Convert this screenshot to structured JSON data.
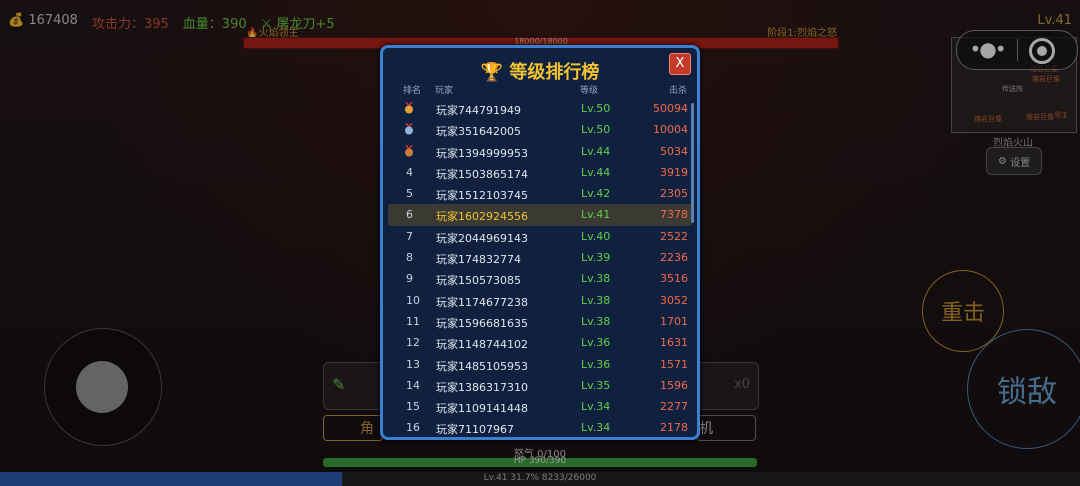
{
  "hud": {
    "gold": "167408",
    "attack": "攻击力：395",
    "health": "血量：390",
    "weapon": "屠龙刀+5",
    "level": "Lv.41"
  },
  "boss": {
    "name": "火焰领主",
    "stage": "阶段1:烈焰之怒",
    "hp_text": "18000/18000",
    "hp_fraction": 1.0
  },
  "minimap": {
    "name": "烈焰火山",
    "labels": [
      "熔岩巨像",
      "传送阵",
      "熔岩巨像",
      "熔岩巨像",
      "熔岩巨像",
      "领主"
    ]
  },
  "settings_label": "设置",
  "controls": {
    "heavy_attack": "重击",
    "lock_target": "锁敌"
  },
  "bottom": {
    "pen_count": "x0",
    "left_button": "角",
    "right_button": "机",
    "rage": "怒气 0/100",
    "hp": "HP 390/390",
    "hp_fraction": 1.0,
    "exp": "Lv.41  31.7%  8233/26000",
    "exp_fraction": 0.317
  },
  "leaderboard": {
    "title": "等级排行榜",
    "close": "X",
    "headers": {
      "rank": "排名",
      "player": "玩家",
      "level": "等级",
      "kills": "击杀"
    },
    "rows": [
      {
        "rank": "1",
        "name": "玩家744791949",
        "level": "Lv.50",
        "kills": "50094",
        "medal": "gold"
      },
      {
        "rank": "2",
        "name": "玩家351642005",
        "level": "Lv.50",
        "kills": "10004",
        "medal": "silver"
      },
      {
        "rank": "3",
        "name": "玩家1394999953",
        "level": "Lv.44",
        "kills": "5034",
        "medal": "bronze"
      },
      {
        "rank": "4",
        "name": "玩家1503865174",
        "level": "Lv.44",
        "kills": "3919"
      },
      {
        "rank": "5",
        "name": "玩家1512103745",
        "level": "Lv.42",
        "kills": "2305"
      },
      {
        "rank": "6",
        "name": "玩家1602924556",
        "level": "Lv.41",
        "kills": "7378",
        "current": true
      },
      {
        "rank": "7",
        "name": "玩家2044969143",
        "level": "Lv.40",
        "kills": "2522"
      },
      {
        "rank": "8",
        "name": "玩家174832774",
        "level": "Lv.39",
        "kills": "2236"
      },
      {
        "rank": "9",
        "name": "玩家150573085",
        "level": "Lv.38",
        "kills": "3516"
      },
      {
        "rank": "10",
        "name": "玩家1174677238",
        "level": "Lv.38",
        "kills": "3052"
      },
      {
        "rank": "11",
        "name": "玩家1596681635",
        "level": "Lv.38",
        "kills": "1701"
      },
      {
        "rank": "12",
        "name": "玩家1148744102",
        "level": "Lv.36",
        "kills": "1631"
      },
      {
        "rank": "13",
        "name": "玩家1485105953",
        "level": "Lv.36",
        "kills": "1571"
      },
      {
        "rank": "14",
        "name": "玩家1386317310",
        "level": "Lv.35",
        "kills": "1596"
      },
      {
        "rank": "15",
        "name": "玩家1109141448",
        "level": "Lv.34",
        "kills": "2277"
      },
      {
        "rank": "16",
        "name": "玩家71107967",
        "level": "Lv.34",
        "kills": "2178"
      }
    ]
  },
  "colors": {
    "modal_border": "#3b7fd1",
    "modal_bg": "#10213f",
    "title": "#f1c232",
    "level_green": "#5fcf4a",
    "kills_red": "#f06a4a",
    "medal_gold": "#e0a03a",
    "medal_silver": "#8fb3d9",
    "medal_bronze": "#d07a3a"
  }
}
